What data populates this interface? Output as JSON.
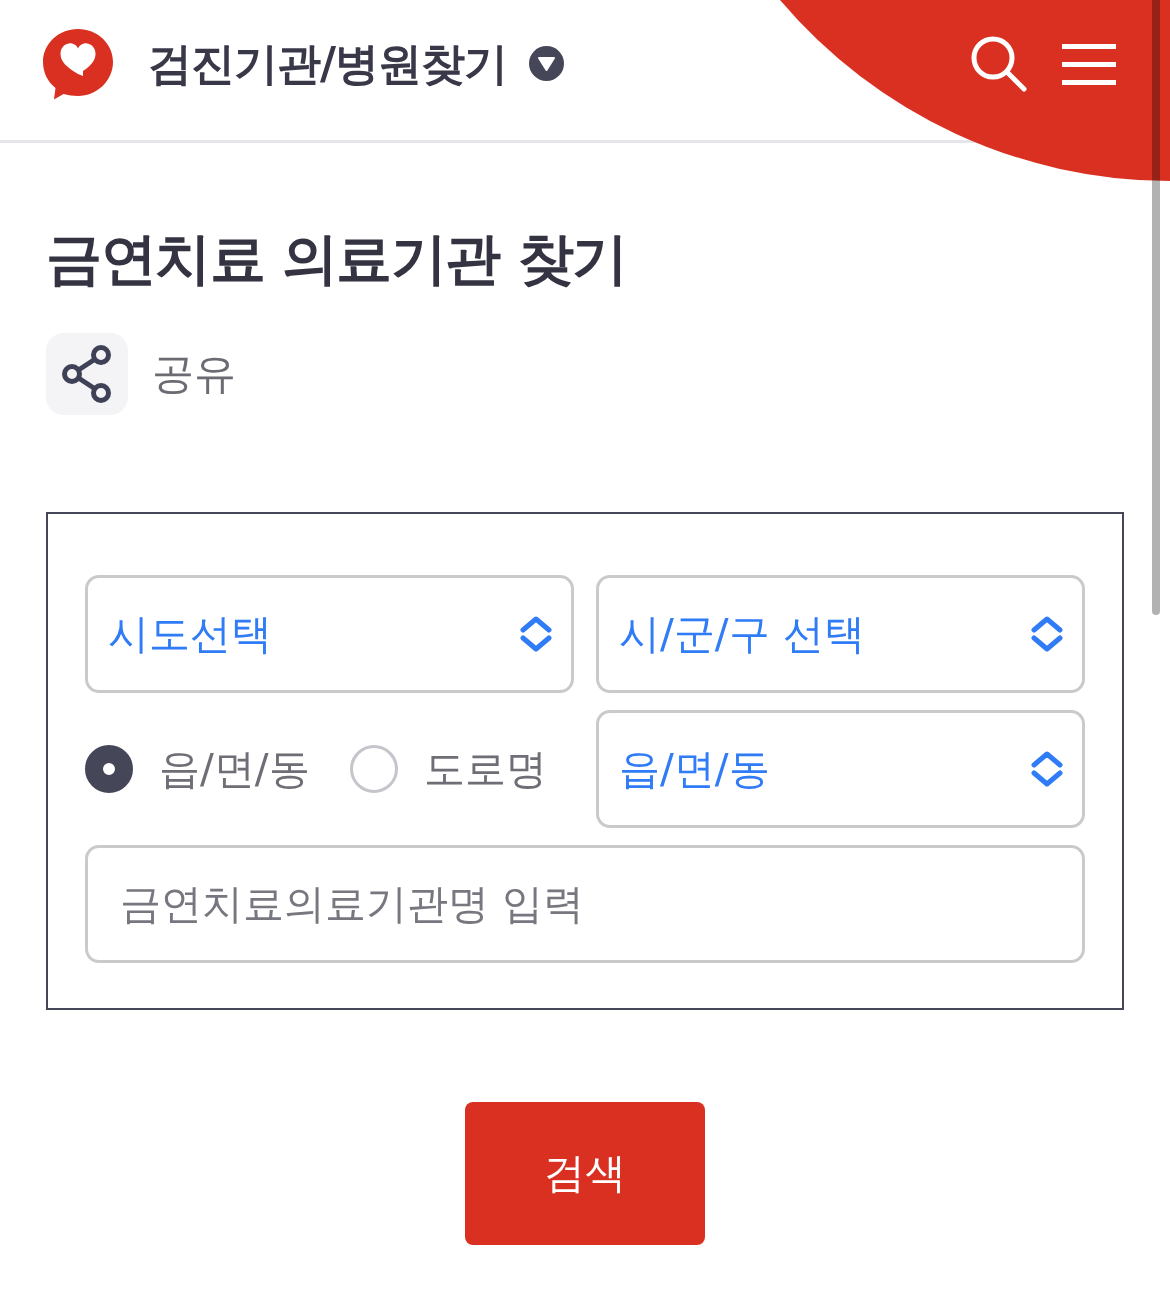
{
  "header": {
    "title": "검진기관/병원찾기"
  },
  "page": {
    "heading": "금연치료 의료기관 찾기",
    "share": {
      "label": "공유"
    }
  },
  "search_form": {
    "selects": [
      {
        "value": "시도선택"
      },
      {
        "value": "시/군/구 선택"
      },
      {
        "value": "읍/면/동"
      }
    ],
    "address_types": [
      {
        "label": "읍/면/동",
        "selected": true
      },
      {
        "label": "도로명",
        "selected": false
      }
    ],
    "name_field": {
      "placeholder": "금연치료의료기관명 입력"
    }
  },
  "search_button": {
    "label": "검색"
  }
}
